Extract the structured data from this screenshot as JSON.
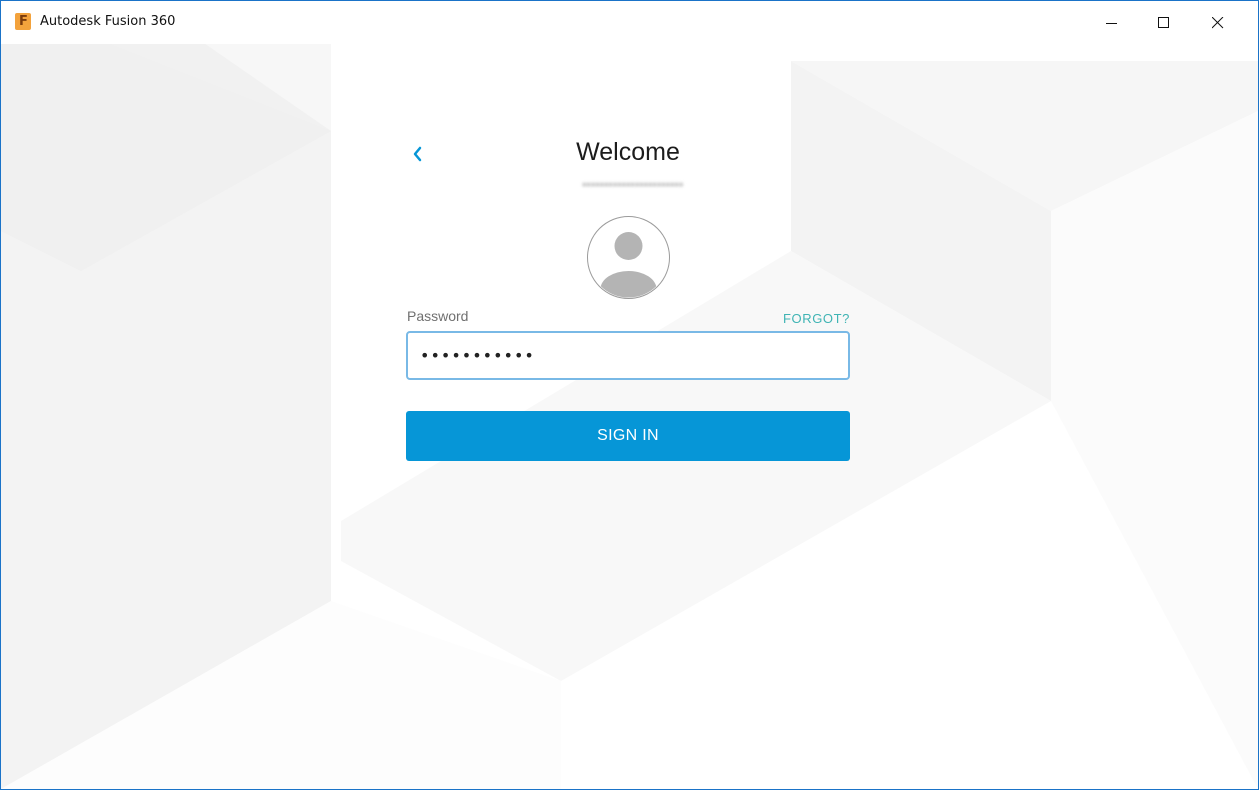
{
  "window": {
    "title": "Autodesk Fusion 360",
    "app_icon_letter": "F",
    "controls": [
      "minimize-icon",
      "maximize-icon",
      "close-icon"
    ]
  },
  "login": {
    "heading": "Welcome",
    "email_masked": "▪▪▪▪▪▪▪▪▪▪▪▪▪▪▪▪▪▪▪▪▪▪▪",
    "password_label": "Password",
    "forgot_label": "FORGOT?",
    "password_value": "•••••••••••",
    "sign_in_label": "SIGN IN"
  },
  "colors": {
    "accent": "#0696d7",
    "forgot_link": "#3fb4b4",
    "input_focus_border": "#79b9e6",
    "window_border": "#1a73c8"
  },
  "icons": {
    "back": "chevron-left-icon",
    "avatar": "user-avatar-icon"
  }
}
